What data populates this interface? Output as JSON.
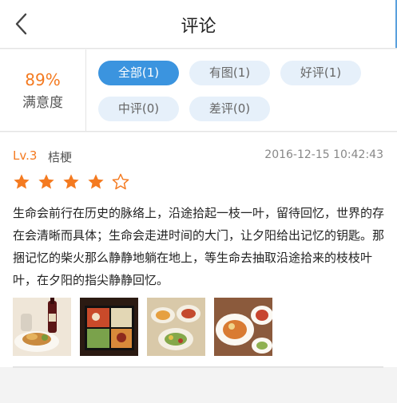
{
  "header": {
    "title": "评论",
    "back_icon": "chevron-left-icon"
  },
  "summary": {
    "rate_value": "89%",
    "rate_label": "满意度",
    "filters": [
      {
        "label": "全部(1)",
        "active": true
      },
      {
        "label": "有图(1)",
        "active": false
      },
      {
        "label": "好评(1)",
        "active": false
      },
      {
        "label": "中评(0)",
        "active": false
      },
      {
        "label": "差评(0)",
        "active": false
      }
    ]
  },
  "review": {
    "level": "Lv.3",
    "username": "桔梗",
    "date": "2016-12-15 10:42:43",
    "rating": 4,
    "rating_max": 5,
    "star_icon": "star-icon",
    "text": "生命会前行在历史的脉络上，沿途拾起一枝一叶，留待回忆，世界的存在会清晰而具体；生命会走进时间的大门，让夕阳给出记忆的钥匙。那捆记忆的柴火那么静静地躺在地上，等生命去抽取沿途拾来的枝枝叶叶，在夕阳的指尖静静回忆。",
    "photos": [
      "food-photo-1",
      "food-photo-2",
      "food-photo-3",
      "food-photo-4"
    ]
  },
  "colors": {
    "accent": "#f47a20",
    "chip_active": "#3b94df",
    "chip": "#e6f0fa"
  }
}
